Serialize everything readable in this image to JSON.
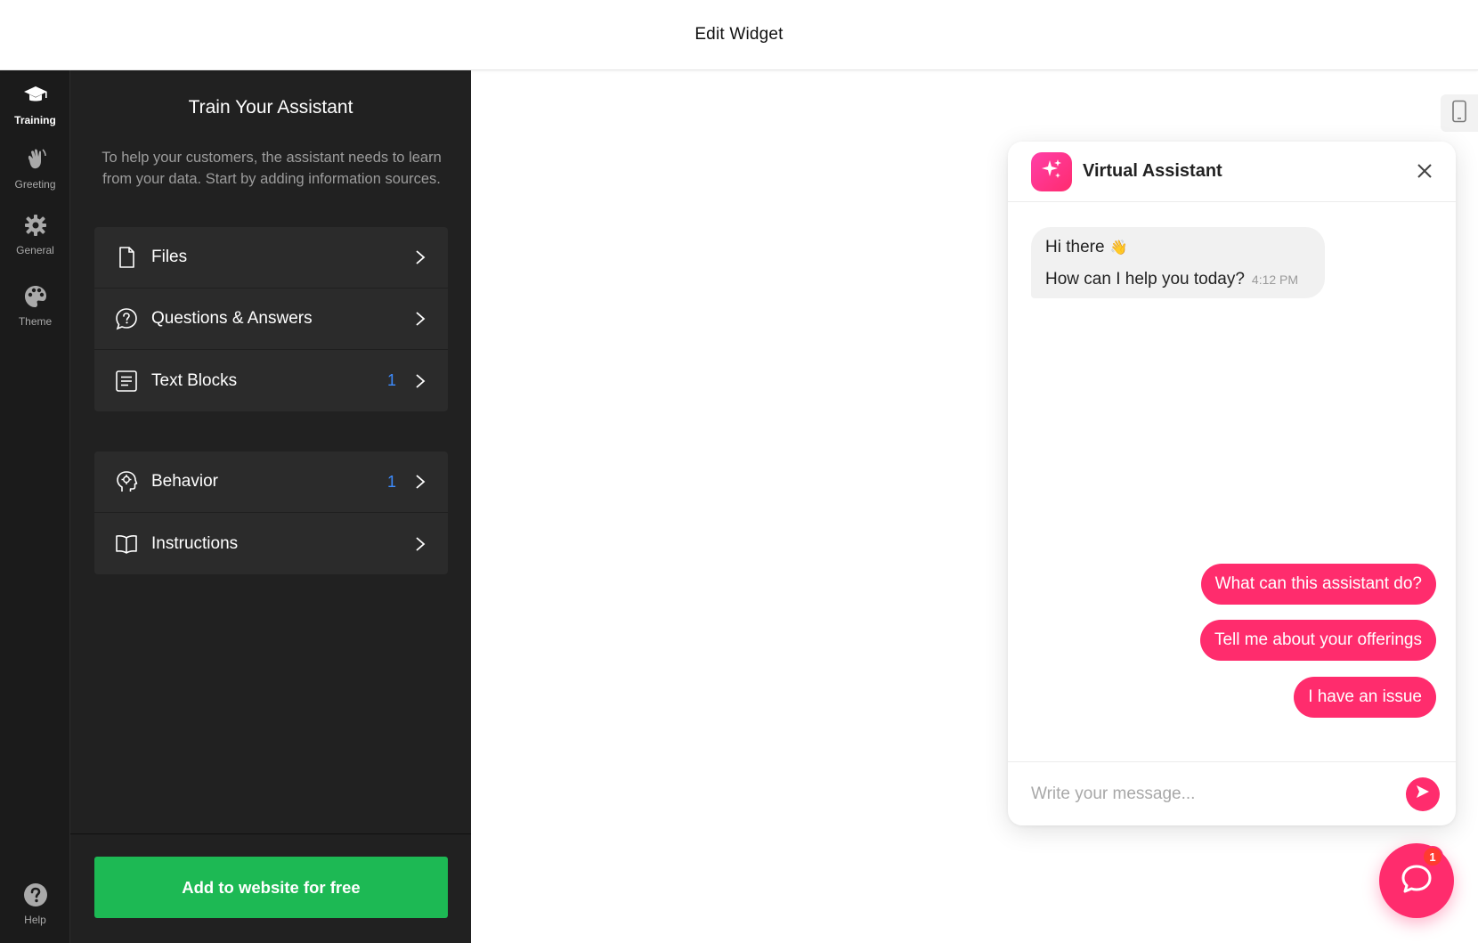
{
  "header": {
    "title": "Edit Widget"
  },
  "rail": {
    "items": [
      {
        "label": "Training",
        "icon": "graduation-cap-icon",
        "active": true
      },
      {
        "label": "Greeting",
        "icon": "waving-hand-icon",
        "active": false
      },
      {
        "label": "General",
        "icon": "gear-icon",
        "active": false
      },
      {
        "label": "Theme",
        "icon": "palette-icon",
        "active": false
      }
    ],
    "help": {
      "label": "Help",
      "icon": "help-icon"
    }
  },
  "panel": {
    "title": "Train Your Assistant",
    "description": "To help your customers, the assistant needs to learn from your data. Start by adding information sources.",
    "sources": [
      {
        "label": "Files",
        "icon": "file-icon",
        "count": ""
      },
      {
        "label": "Questions & Answers",
        "icon": "question-bubble-icon",
        "count": ""
      },
      {
        "label": "Text Blocks",
        "icon": "text-block-icon",
        "count": "1"
      }
    ],
    "settings": [
      {
        "label": "Behavior",
        "icon": "head-gear-icon",
        "count": "1"
      },
      {
        "label": "Instructions",
        "icon": "book-icon",
        "count": ""
      }
    ],
    "cta": "Add to website for free"
  },
  "chat": {
    "name": "Virtual Assistant",
    "greeting_line1": "Hi there",
    "greeting_emoji": "👋",
    "greeting_line2": "How can I help you today?",
    "greeting_time": "4:12 PM",
    "quick_replies": [
      "What can this assistant do?",
      "Tell me about your offerings",
      "I have an issue"
    ],
    "input_placeholder": "Write your message...",
    "launcher_badge": "1"
  },
  "colors": {
    "accent": "#ff2c6d",
    "cta_green": "#1db954",
    "panel_bg": "#212121",
    "rail_bg": "#1b1b1b",
    "count_blue": "#3d8cff"
  }
}
